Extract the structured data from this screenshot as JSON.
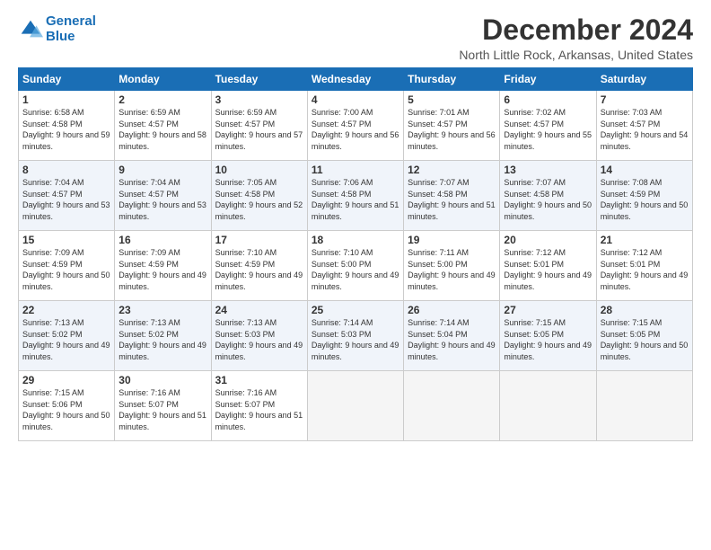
{
  "header": {
    "logo_line1": "General",
    "logo_line2": "Blue",
    "month_title": "December 2024",
    "location": "North Little Rock, Arkansas, United States"
  },
  "days_of_week": [
    "Sunday",
    "Monday",
    "Tuesday",
    "Wednesday",
    "Thursday",
    "Friday",
    "Saturday"
  ],
  "weeks": [
    [
      {
        "day": 1,
        "sunrise": "6:58 AM",
        "sunset": "4:58 PM",
        "daylight": "9 hours and 59 minutes."
      },
      {
        "day": 2,
        "sunrise": "6:59 AM",
        "sunset": "4:57 PM",
        "daylight": "9 hours and 58 minutes."
      },
      {
        "day": 3,
        "sunrise": "6:59 AM",
        "sunset": "4:57 PM",
        "daylight": "9 hours and 57 minutes."
      },
      {
        "day": 4,
        "sunrise": "7:00 AM",
        "sunset": "4:57 PM",
        "daylight": "9 hours and 56 minutes."
      },
      {
        "day": 5,
        "sunrise": "7:01 AM",
        "sunset": "4:57 PM",
        "daylight": "9 hours and 56 minutes."
      },
      {
        "day": 6,
        "sunrise": "7:02 AM",
        "sunset": "4:57 PM",
        "daylight": "9 hours and 55 minutes."
      },
      {
        "day": 7,
        "sunrise": "7:03 AM",
        "sunset": "4:57 PM",
        "daylight": "9 hours and 54 minutes."
      }
    ],
    [
      {
        "day": 8,
        "sunrise": "7:04 AM",
        "sunset": "4:57 PM",
        "daylight": "9 hours and 53 minutes."
      },
      {
        "day": 9,
        "sunrise": "7:04 AM",
        "sunset": "4:57 PM",
        "daylight": "9 hours and 53 minutes."
      },
      {
        "day": 10,
        "sunrise": "7:05 AM",
        "sunset": "4:58 PM",
        "daylight": "9 hours and 52 minutes."
      },
      {
        "day": 11,
        "sunrise": "7:06 AM",
        "sunset": "4:58 PM",
        "daylight": "9 hours and 51 minutes."
      },
      {
        "day": 12,
        "sunrise": "7:07 AM",
        "sunset": "4:58 PM",
        "daylight": "9 hours and 51 minutes."
      },
      {
        "day": 13,
        "sunrise": "7:07 AM",
        "sunset": "4:58 PM",
        "daylight": "9 hours and 50 minutes."
      },
      {
        "day": 14,
        "sunrise": "7:08 AM",
        "sunset": "4:59 PM",
        "daylight": "9 hours and 50 minutes."
      }
    ],
    [
      {
        "day": 15,
        "sunrise": "7:09 AM",
        "sunset": "4:59 PM",
        "daylight": "9 hours and 50 minutes."
      },
      {
        "day": 16,
        "sunrise": "7:09 AM",
        "sunset": "4:59 PM",
        "daylight": "9 hours and 49 minutes."
      },
      {
        "day": 17,
        "sunrise": "7:10 AM",
        "sunset": "4:59 PM",
        "daylight": "9 hours and 49 minutes."
      },
      {
        "day": 18,
        "sunrise": "7:10 AM",
        "sunset": "5:00 PM",
        "daylight": "9 hours and 49 minutes."
      },
      {
        "day": 19,
        "sunrise": "7:11 AM",
        "sunset": "5:00 PM",
        "daylight": "9 hours and 49 minutes."
      },
      {
        "day": 20,
        "sunrise": "7:12 AM",
        "sunset": "5:01 PM",
        "daylight": "9 hours and 49 minutes."
      },
      {
        "day": 21,
        "sunrise": "7:12 AM",
        "sunset": "5:01 PM",
        "daylight": "9 hours and 49 minutes."
      }
    ],
    [
      {
        "day": 22,
        "sunrise": "7:13 AM",
        "sunset": "5:02 PM",
        "daylight": "9 hours and 49 minutes."
      },
      {
        "day": 23,
        "sunrise": "7:13 AM",
        "sunset": "5:02 PM",
        "daylight": "9 hours and 49 minutes."
      },
      {
        "day": 24,
        "sunrise": "7:13 AM",
        "sunset": "5:03 PM",
        "daylight": "9 hours and 49 minutes."
      },
      {
        "day": 25,
        "sunrise": "7:14 AM",
        "sunset": "5:03 PM",
        "daylight": "9 hours and 49 minutes."
      },
      {
        "day": 26,
        "sunrise": "7:14 AM",
        "sunset": "5:04 PM",
        "daylight": "9 hours and 49 minutes."
      },
      {
        "day": 27,
        "sunrise": "7:15 AM",
        "sunset": "5:05 PM",
        "daylight": "9 hours and 49 minutes."
      },
      {
        "day": 28,
        "sunrise": "7:15 AM",
        "sunset": "5:05 PM",
        "daylight": "9 hours and 50 minutes."
      }
    ],
    [
      {
        "day": 29,
        "sunrise": "7:15 AM",
        "sunset": "5:06 PM",
        "daylight": "9 hours and 50 minutes."
      },
      {
        "day": 30,
        "sunrise": "7:16 AM",
        "sunset": "5:07 PM",
        "daylight": "9 hours and 51 minutes."
      },
      {
        "day": 31,
        "sunrise": "7:16 AM",
        "sunset": "5:07 PM",
        "daylight": "9 hours and 51 minutes."
      },
      null,
      null,
      null,
      null
    ]
  ],
  "labels": {
    "sunrise": "Sunrise:",
    "sunset": "Sunset:",
    "daylight": "Daylight:"
  }
}
